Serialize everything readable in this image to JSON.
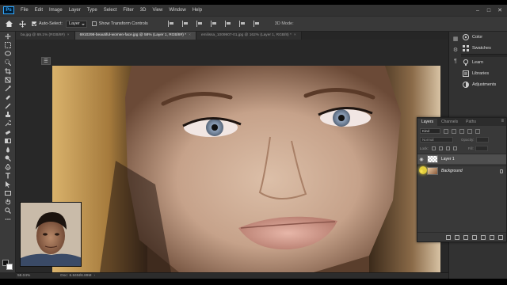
{
  "app": {
    "logo": "Ps",
    "menu": [
      "File",
      "Edit",
      "Image",
      "Layer",
      "Type",
      "Select",
      "Filter",
      "3D",
      "View",
      "Window",
      "Help"
    ]
  },
  "options_bar": {
    "auto_select_label": "Auto-Select:",
    "auto_select_value": "Layer",
    "transform_label": "Show Transform Controls",
    "mode_3d": "3D Mode:"
  },
  "tabs": [
    {
      "label": "ba.jpg @ 69.1% (RGB/8#)",
      "active": false
    },
    {
      "label": "6910298-beautiful-women-face.jpg @ 58% (Layer 1, RGB/8#) *",
      "active": true
    },
    {
      "label": "emilissa_1009907-01.jpg @ 162% (Layer 1, RGB/8) *",
      "active": false
    }
  ],
  "status": {
    "zoom": "58.04%",
    "doc": "Doc: 6.84M/6.89M"
  },
  "right_panels": {
    "items": [
      {
        "label": "Color",
        "icon": "color-wheel-icon"
      },
      {
        "label": "Swatches",
        "icon": "swatches-grid-icon"
      },
      {
        "label": "Learn",
        "icon": "lightbulb-icon"
      },
      {
        "label": "Libraries",
        "icon": "libraries-icon"
      },
      {
        "label": "Adjustments",
        "icon": "adjustments-circle-icon"
      }
    ]
  },
  "layers_panel": {
    "tabs": [
      "Layers",
      "Channels",
      "Paths"
    ],
    "kind": "Kind",
    "blend_mode": "Normal",
    "opacity_label": "Opacity:",
    "lock_label": "Lock:",
    "fill_label": "Fill:",
    "layers": [
      {
        "name": "Layer 1",
        "selected": true,
        "italic": false
      },
      {
        "name": "Background",
        "selected": false,
        "italic": true
      }
    ]
  },
  "colors": {
    "accent": "#31a8ff",
    "ui_dark": "#282828",
    "panel": "#393939",
    "cursor_highlight": "#ffe63c"
  }
}
